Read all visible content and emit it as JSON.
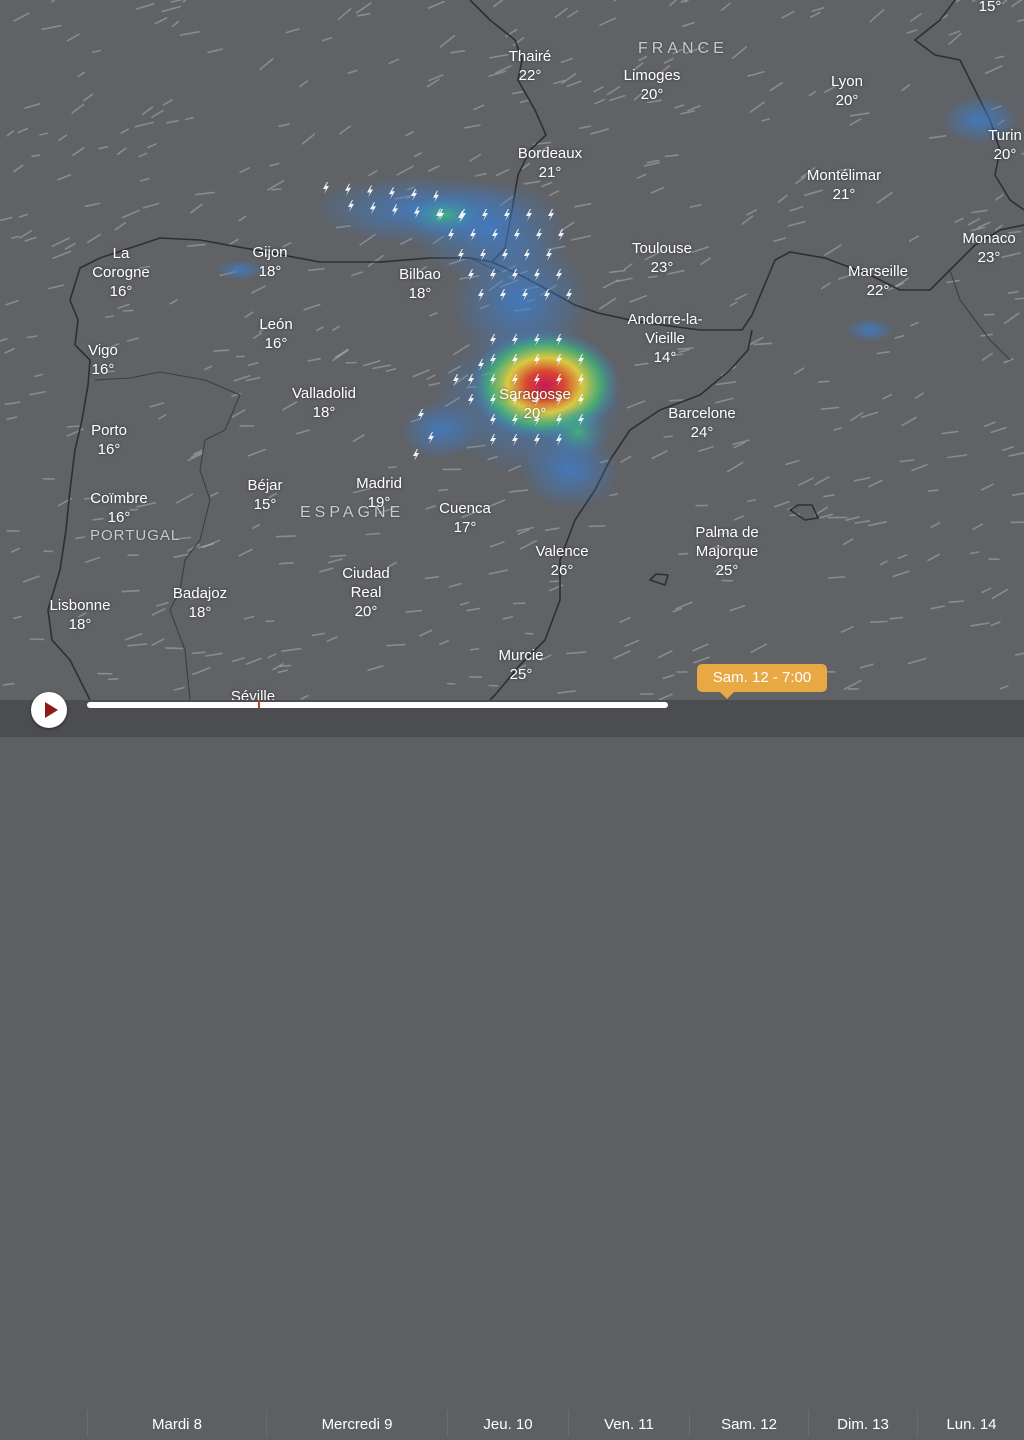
{
  "map": {
    "countries": [
      {
        "id": "france",
        "label": "FRANCE"
      },
      {
        "id": "espagne",
        "label": "ESPAGNE"
      },
      {
        "id": "portugal",
        "label": "PORTUGAL"
      }
    ],
    "cities": [
      {
        "id": "thaire",
        "name": "Thairé",
        "temp": "22°"
      },
      {
        "id": "limoges",
        "name": "Limoges",
        "temp": "20°"
      },
      {
        "id": "lyon",
        "name": "Lyon",
        "temp": "20°"
      },
      {
        "id": "turin",
        "name": "Turin",
        "temp": "20°"
      },
      {
        "id": "top-right",
        "name": "",
        "temp": "15°"
      },
      {
        "id": "bordeaux",
        "name": "Bordeaux",
        "temp": "21°"
      },
      {
        "id": "montelimar",
        "name": "Montélimar",
        "temp": "21°"
      },
      {
        "id": "monaco",
        "name": "Monaco",
        "temp": "23°"
      },
      {
        "id": "marseille",
        "name": "Marseille",
        "temp": "22°"
      },
      {
        "id": "toulouse",
        "name": "Toulouse",
        "temp": "23°"
      },
      {
        "id": "la-corogne",
        "name": "La Corogne",
        "temp": "16°"
      },
      {
        "id": "gijon",
        "name": "Gijon",
        "temp": "18°"
      },
      {
        "id": "bilbao",
        "name": "Bilbao",
        "temp": "18°"
      },
      {
        "id": "leon",
        "name": "León",
        "temp": "16°"
      },
      {
        "id": "andorre",
        "name": "Andorre-la- Vieille",
        "temp": "14°"
      },
      {
        "id": "vigo",
        "name": "Vigo",
        "temp": "16°"
      },
      {
        "id": "valladolid",
        "name": "Valladolid",
        "temp": "18°"
      },
      {
        "id": "saragosse",
        "name": "Saragosse",
        "temp": "20°"
      },
      {
        "id": "barcelone",
        "name": "Barcelone",
        "temp": "24°"
      },
      {
        "id": "porto",
        "name": "Porto",
        "temp": "16°"
      },
      {
        "id": "bejar",
        "name": "Béjar",
        "temp": "15°"
      },
      {
        "id": "madrid",
        "name": "Madrid",
        "temp": "19°"
      },
      {
        "id": "coimbre",
        "name": "Coïmbre",
        "temp": "16°"
      },
      {
        "id": "cuenca",
        "name": "Cuenca",
        "temp": "17°"
      },
      {
        "id": "palma",
        "name": "Palma de Majorque",
        "temp": "25°"
      },
      {
        "id": "valence",
        "name": "Valence",
        "temp": "26°"
      },
      {
        "id": "ciudad-real",
        "name": "Ciudad Real",
        "temp": "20°"
      },
      {
        "id": "badajoz",
        "name": "Badajoz",
        "temp": "18°"
      },
      {
        "id": "lisbonne",
        "name": "Lisbonne",
        "temp": "18°"
      },
      {
        "id": "murcie",
        "name": "Murcie",
        "temp": "25°"
      },
      {
        "id": "seville",
        "name": "Séville",
        "temp": ""
      }
    ],
    "layer": "thunderstorm-radar",
    "colors": {
      "land": "#606265",
      "sea": "#5e6064",
      "precip_low": "#3b7fd4",
      "precip_mid": "#3fbf72",
      "precip_high": "#e8d33a",
      "precip_peak": "#c2185b"
    }
  },
  "timeline": {
    "play_icon": "play-icon",
    "current_time_label": "Sam. 12 - 7:00",
    "progress_percent": 62,
    "days": [
      "Mardi 8",
      "Mercredi 9",
      "Jeu. 10",
      "Ven. 11",
      "Sam. 12",
      "Dim. 13",
      "Lun. 14"
    ]
  }
}
